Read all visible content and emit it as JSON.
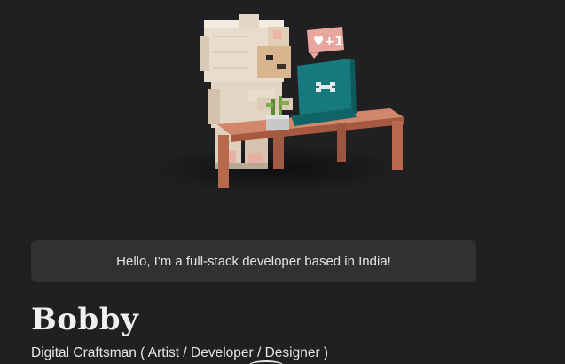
{
  "greeting": "Hello, I'm a full-stack developer based in India!",
  "profile": {
    "name": "Bobby",
    "tagline": "Digital Craftsman ( Artist / Developer / Designer )"
  },
  "hero": {
    "badge_text": "♥+1",
    "monitor_icon": "bone-icon"
  },
  "colors": {
    "background": "#202023",
    "greeting_box": "#313134",
    "monitor": "#1a8a8f",
    "desk": "#c2775a",
    "badge": "#e8a8a0"
  }
}
